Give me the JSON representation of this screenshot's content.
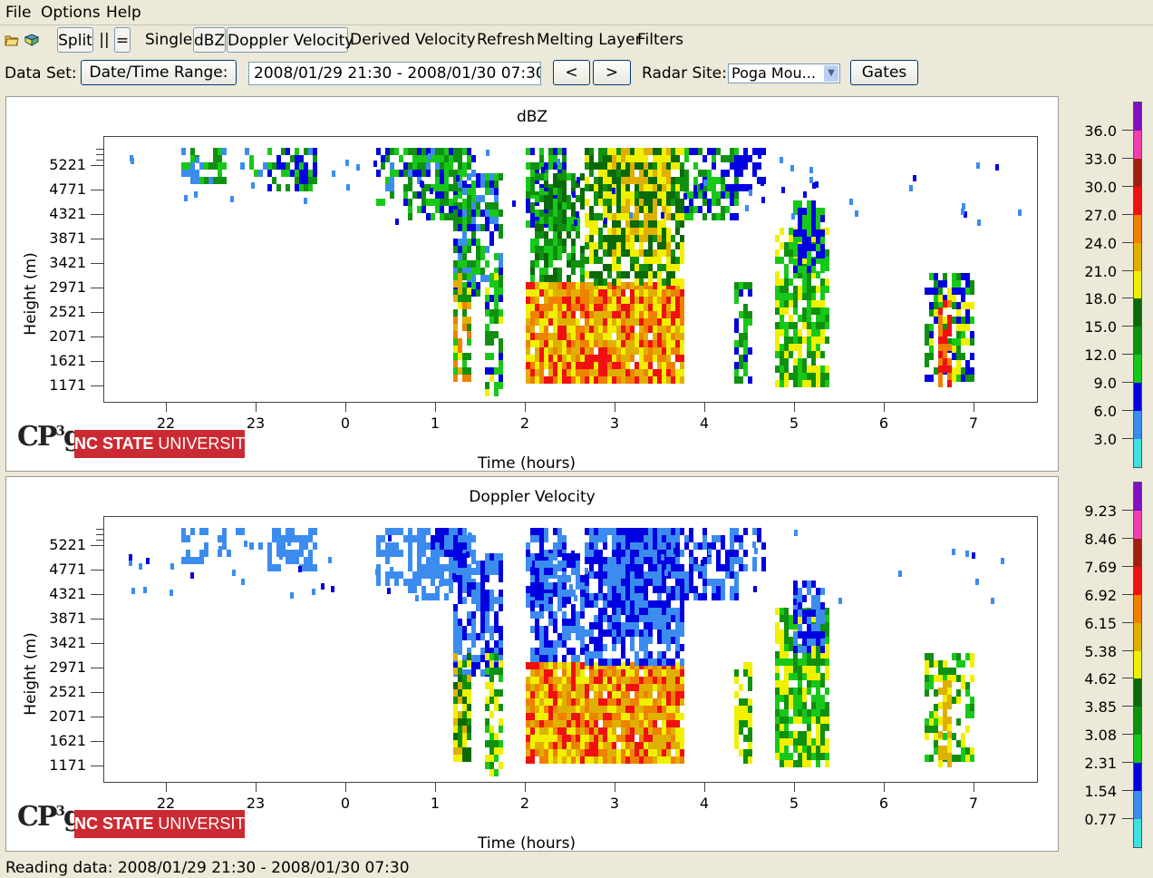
{
  "menu": {
    "file": "File",
    "options": "Options",
    "help": "Help"
  },
  "toolbar": {
    "open_icon": "open-folder-icon",
    "book_icon": "book-icon",
    "split": "Split",
    "vertical": "||",
    "horizontal": "=",
    "single": "Single",
    "dbz": "dBZ",
    "doppler": "Doppler Velocity",
    "derived": "Derived Velocity",
    "refresh": "Refresh",
    "melting": "Melting Layer",
    "filters": "Filters"
  },
  "dataset": {
    "label": "Data Set:",
    "range_button": "Date/Time Range:",
    "range_value": "2008/01/29 21:30 - 2008/01/30 07:30",
    "prev": "<",
    "next": ">",
    "site_label": "Radar Site:",
    "site_value": "Poga Mou...",
    "gates": "Gates"
  },
  "panels": [
    {
      "title": "dBZ",
      "y_title": "Height (m)",
      "x_title": "Time (hours)",
      "y_ticks": [
        "5221",
        "4771",
        "4321",
        "3871",
        "3421",
        "2971",
        "2521",
        "2071",
        "1621",
        "1171"
      ],
      "x_ticks": [
        "22",
        "23",
        "0",
        "1",
        "2",
        "3",
        "4",
        "5",
        "6",
        "7"
      ],
      "colorbar_labels": [
        "36.0",
        "33.0",
        "30.0",
        "27.0",
        "24.0",
        "21.0",
        "18.0",
        "15.0",
        "12.0",
        "9.0",
        "6.0",
        "3.0"
      ]
    },
    {
      "title": "Doppler Velocity",
      "y_title": "Height (m)",
      "x_title": "Time (hours)",
      "y_ticks": [
        "5221",
        "4771",
        "4321",
        "3871",
        "3421",
        "2971",
        "2521",
        "2071",
        "1621",
        "1171"
      ],
      "x_ticks": [
        "22",
        "23",
        "0",
        "1",
        "2",
        "3",
        "4",
        "5",
        "6",
        "7"
      ],
      "colorbar_labels": [
        "9.23",
        "8.46",
        "7.69",
        "6.92",
        "6.15",
        "5.38",
        "4.62",
        "3.85",
        "3.08",
        "2.31",
        "1.54",
        "0.77"
      ]
    }
  ],
  "logo": {
    "cp": "CP",
    "sup": "3",
    "g": "g",
    "univ_bold": "NC STATE",
    "univ_rest": " UNIVERSITY"
  },
  "colorscale": [
    "#40e0e0",
    "#3c8cf0",
    "#0000e0",
    "#18c818",
    "#109010",
    "#0a6a0a",
    "#f0f000",
    "#e0b000",
    "#f08000",
    "#f01010",
    "#a02010",
    "#f040b0",
    "#8010c0"
  ],
  "status": "Reading data: 2008/01/29 21:30 - 2008/01/30 07:30"
}
